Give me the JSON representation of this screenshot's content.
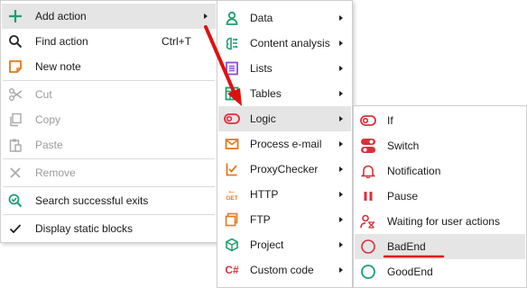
{
  "context_menu": {
    "add_action": "Add action",
    "find_action": "Find action",
    "find_action_shortcut": "Ctrl+T",
    "new_note": "New note",
    "cut": "Cut",
    "copy": "Copy",
    "paste": "Paste",
    "remove": "Remove",
    "search_successful_exits": "Search successful exits",
    "display_static_blocks": "Display static blocks"
  },
  "action_categories": {
    "data": "Data",
    "content_analysis": "Content analysis",
    "lists": "Lists",
    "tables": "Tables",
    "logic": "Logic",
    "process_email": "Process e-mail",
    "proxychecker": "ProxyChecker",
    "http": "HTTP",
    "http_icon_top": "←",
    "http_icon_bottom": "GET",
    "ftp": "FTP",
    "project": "Project",
    "custom_code": "Custom code",
    "custom_code_icon": "C#"
  },
  "logic_submenu": {
    "if": "If",
    "switch": "Switch",
    "notification": "Notification",
    "pause": "Pause",
    "waiting_for_user_actions": "Waiting for user actions",
    "badend": "BadEnd",
    "goodend": "GoodEnd"
  },
  "colors": {
    "green": "#1e9e6e",
    "orange": "#e8771a",
    "purple": "#8a4fc9",
    "red": "#d9303a",
    "highlight": "#e5e5e5",
    "annotation": "#e01010"
  }
}
